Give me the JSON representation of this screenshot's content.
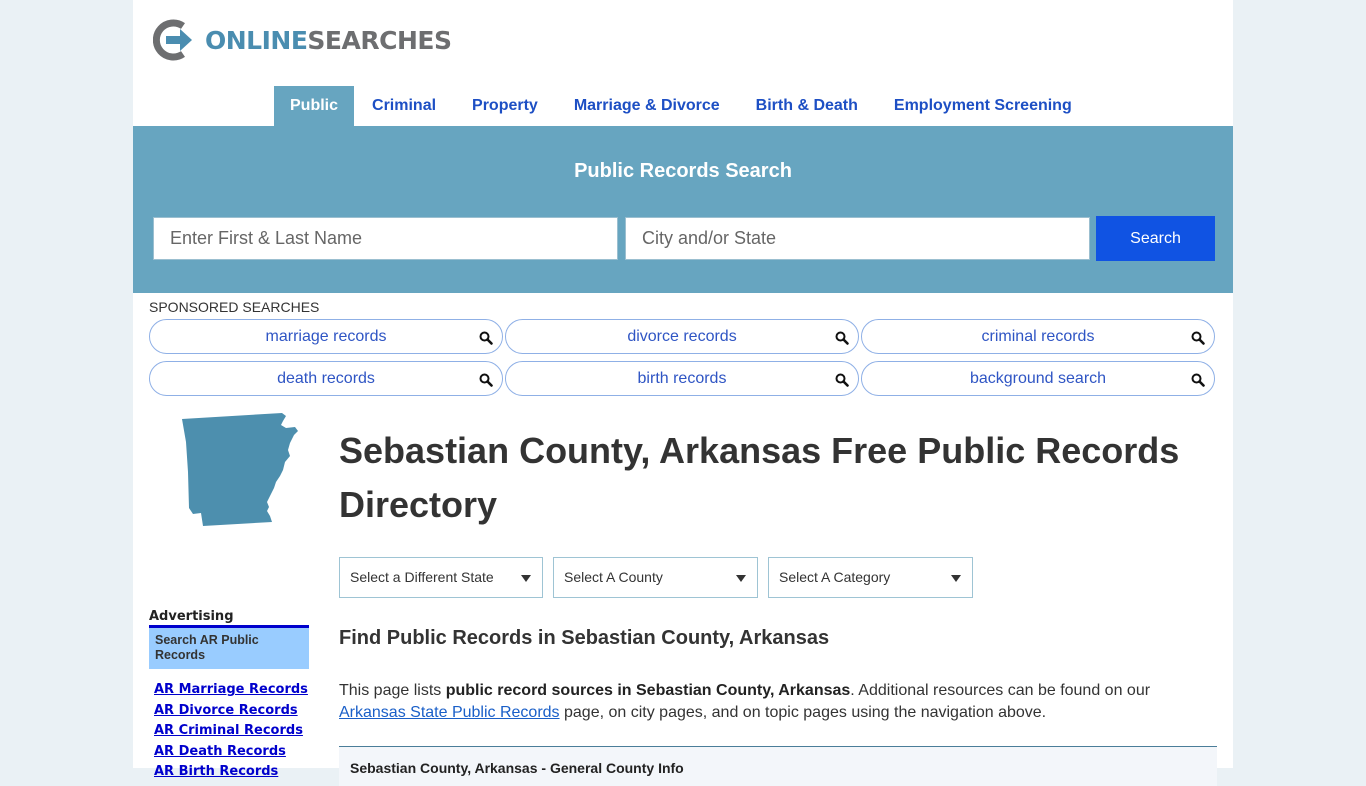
{
  "brand": {
    "logo_word1": "ONLINE",
    "logo_word2": "SEARCHES",
    "colors": {
      "accent": "#67a5c0",
      "logo_blue": "#4a8db0",
      "logo_gray": "#6d6e70",
      "search_button": "#1053e3",
      "nav_link": "#1d4fc4"
    }
  },
  "nav": {
    "items": [
      {
        "label": "Public",
        "active": true
      },
      {
        "label": "Criminal"
      },
      {
        "label": "Property"
      },
      {
        "label": "Marriage & Divorce"
      },
      {
        "label": "Birth & Death"
      },
      {
        "label": "Employment Screening"
      }
    ]
  },
  "search": {
    "title": "Public Records Search",
    "name_placeholder": "Enter First & Last Name",
    "name_value": "",
    "city_placeholder": "City and/or State",
    "city_value": "",
    "button_label": "Search"
  },
  "sponsored": {
    "label": "SPONSORED SEARCHES",
    "items": [
      {
        "label": "marriage records",
        "icon": "search-icon"
      },
      {
        "label": "divorce records",
        "icon": "search-icon"
      },
      {
        "label": "criminal records",
        "icon": "search-icon"
      },
      {
        "label": "death records",
        "icon": "search-icon"
      },
      {
        "label": "birth records",
        "icon": "search-icon"
      },
      {
        "label": "background search",
        "icon": "search-icon"
      }
    ]
  },
  "main": {
    "title": "Sebastian County, Arkansas Free Public Records Directory",
    "selects": {
      "state": "Select a Different State",
      "county": "Select A County",
      "category": "Select A Category"
    },
    "section_heading": "Find Public Records in Sebastian County, Arkansas",
    "intro": {
      "part1": "This page lists ",
      "bold": "public record sources in Sebastian County, Arkansas",
      "part2": ". Additional resources can be found on our ",
      "link": "Arkansas State Public Records",
      "part3": " page, on city pages, and on topic pages using the navigation above."
    },
    "info_box_title": "Sebastian County, Arkansas - General County Info"
  },
  "sidebar": {
    "advertising_label": "Advertising",
    "ad_box_text": "Search AR Public Records",
    "links": [
      "AR Marriage Records",
      "AR Divorce Records",
      "AR Criminal Records",
      "AR Death Records",
      "AR Birth Records"
    ]
  }
}
